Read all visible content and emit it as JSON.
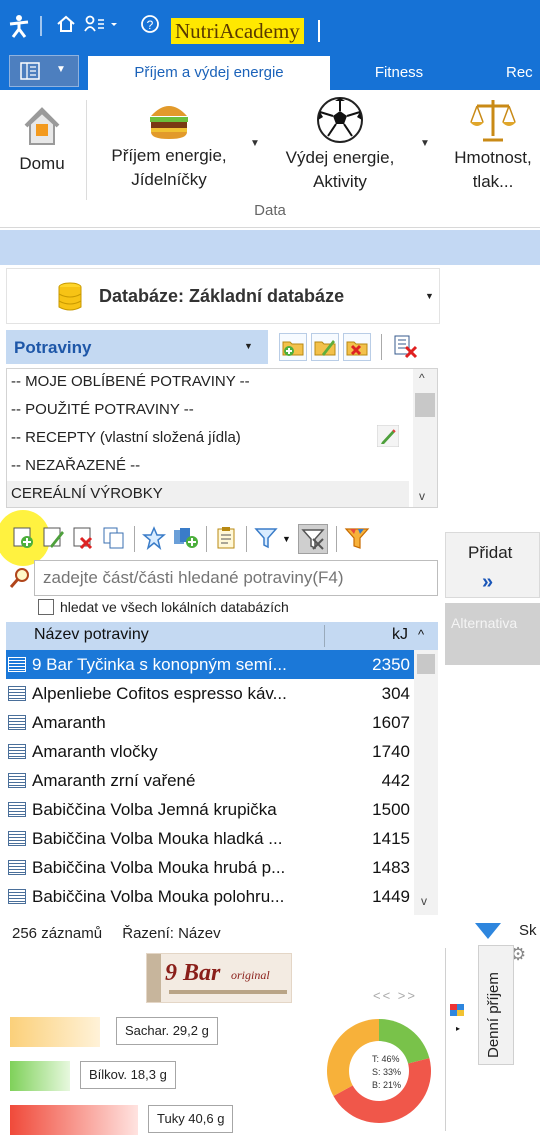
{
  "titlebar": {
    "app_name": "NutriAcademy",
    "icons": [
      "person-logo-icon",
      "home-icon",
      "user-menu-icon",
      "help-icon"
    ]
  },
  "tabs": {
    "active": "Příjem a výdej energie",
    "items": [
      "Fitness",
      "Rec"
    ]
  },
  "ribbon": {
    "home_label": "Domu",
    "intake_label_1": "Příjem energie,",
    "intake_label_2": "Jídelníčky",
    "output_label_1": "Výdej energie,",
    "output_label_2": "Aktivity",
    "weight_label_1": "Hmotnost,",
    "weight_label_2": "tlak...",
    "group_label": "Data"
  },
  "database": {
    "label": "Databáze: Základní databáze"
  },
  "category": {
    "header": "Potraviny",
    "items": [
      "-- MOJE OBLÍBENÉ POTRAVINY --",
      "-- POUŽITÉ POTRAVINY --",
      "-- RECEPTY (vlastní složená jídla)",
      "-- NEZAŘAZENÉ --",
      "CEREÁLNÍ VÝROBKY"
    ]
  },
  "search": {
    "placeholder": "zadejte část/části hledané potraviny(F4)",
    "checkbox_label": "hledat ve všech lokálních databázích"
  },
  "table": {
    "col_name": "Název potraviny",
    "col_kj": "kJ",
    "rows": [
      {
        "name": "9 Bar Tyčinka s konopným semí...",
        "kj": "2350"
      },
      {
        "name": "Alpenliebe Cofitos espresso káv...",
        "kj": "304"
      },
      {
        "name": "Amaranth",
        "kj": "1607"
      },
      {
        "name": "Amaranth vločky",
        "kj": "1740"
      },
      {
        "name": "Amaranth zrní vařené",
        "kj": "442"
      },
      {
        "name": "Babiččina Volba Jemná krupička",
        "kj": "1500"
      },
      {
        "name": "Babiččina Volba Mouka hladká ...",
        "kj": "1415"
      },
      {
        "name": "Babiččina Volba Mouka hrubá p...",
        "kj": "1483"
      },
      {
        "name": "Babiččina Volba Mouka polohru...",
        "kj": "1449"
      }
    ]
  },
  "footer": {
    "records": "256 záznamů",
    "sort": "Řazení: Název"
  },
  "product_image": {
    "brand": "9 Bar",
    "sub": "original"
  },
  "pager": "<< >>",
  "nutrition": {
    "carbs": "Sachar. 29,2 g",
    "protein": "Bílkov. 18,3 g",
    "fat": "Tuky 40,6 g",
    "pie": {
      "t": "T: 46%",
      "s": "S: 33%",
      "b": "B: 21%",
      "fractions": {
        "fat": 0.46,
        "carbs": 0.33,
        "protein": 0.21
      }
    }
  },
  "right": {
    "add": "Přidat",
    "add_arrow": "»",
    "alternatives": "Alternativa",
    "side_tab": "Denní příjem",
    "panel_title": "Sk"
  },
  "colors": {
    "accent": "#1672d6",
    "selected_row": "#1b78d8",
    "header_bg": "#c4d9f2",
    "fat": "#f0574a",
    "carbs": "#f7b13a",
    "protein": "#79c24a"
  }
}
